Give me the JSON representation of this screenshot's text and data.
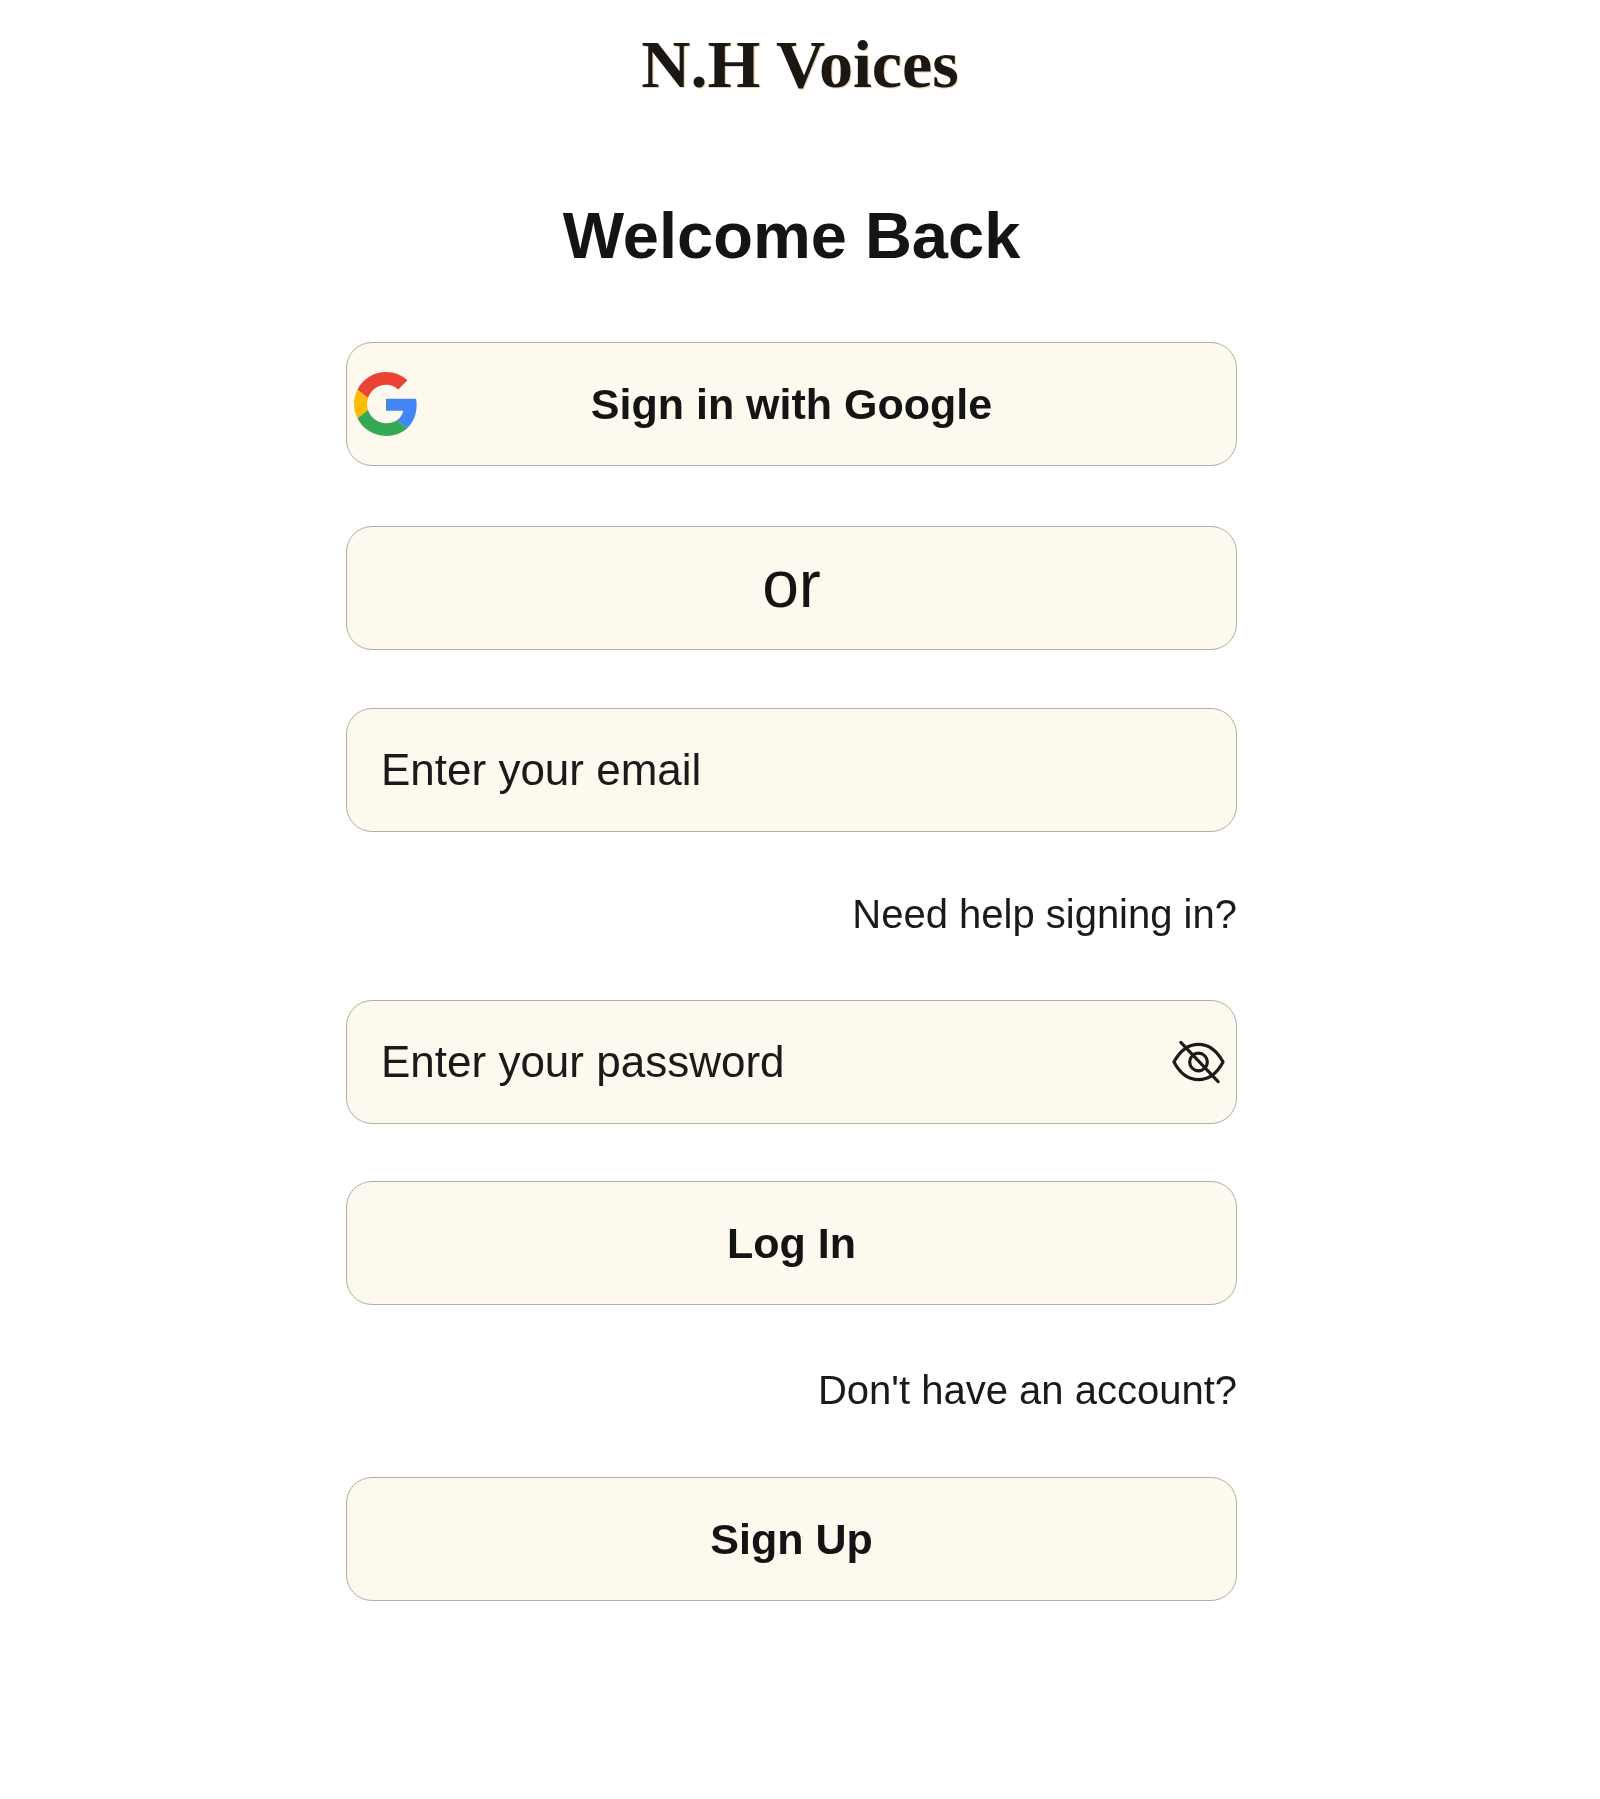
{
  "logo": {
    "text": "N.H Voices"
  },
  "heading": "Welcome Back",
  "google_button": {
    "label": "Sign in with Google"
  },
  "divider": {
    "label": "or"
  },
  "email_field": {
    "placeholder": "Enter your email"
  },
  "help_link": {
    "label": "Need help signing in?"
  },
  "password_field": {
    "placeholder": "Enter your password",
    "visible": false
  },
  "login_button": {
    "label": "Log In"
  },
  "signup_prompt": "Don't have an account?",
  "signup_button": {
    "label": "Sign Up"
  }
}
